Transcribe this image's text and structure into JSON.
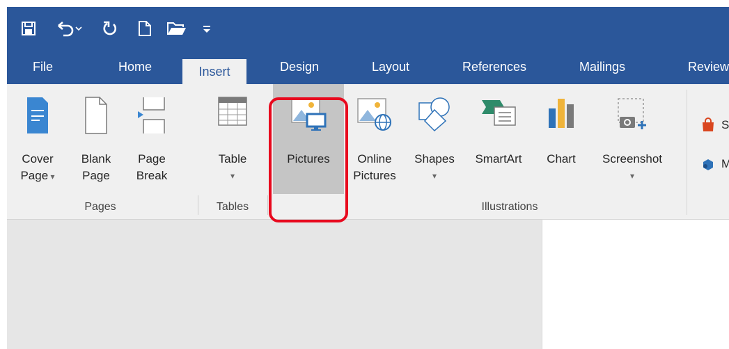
{
  "colors": {
    "accent": "#2b579a",
    "highlight": "#e8091e",
    "ribbon": "#f0f0f0"
  },
  "qat": {
    "items": [
      {
        "name": "save-icon"
      },
      {
        "name": "undo-icon"
      },
      {
        "name": "redo-icon"
      },
      {
        "name": "new-document-icon"
      },
      {
        "name": "open-folder-icon"
      },
      {
        "name": "customize-qat-icon"
      }
    ]
  },
  "tabs": [
    "File",
    "Home",
    "Insert",
    "Design",
    "Layout",
    "References",
    "Mailings",
    "Review"
  ],
  "active_tab": "Insert",
  "groups": {
    "pages": {
      "label": "Pages",
      "cover": {
        "line1": "Cover",
        "line2": "Page"
      },
      "blank": {
        "line1": "Blank",
        "line2": "Page"
      },
      "break": {
        "line1": "Page",
        "line2": "Break"
      }
    },
    "tables": {
      "label": "Tables",
      "table": {
        "line1": "Table"
      }
    },
    "illustrations": {
      "label": "Illustrations",
      "pictures": {
        "line1": "Pictures"
      },
      "online": {
        "line1": "Online",
        "line2": "Pictures"
      },
      "shapes": {
        "line1": "Shapes"
      },
      "smartart": {
        "line1": "SmartArt"
      },
      "chart": {
        "line1": "Chart"
      },
      "screenshot": {
        "line1": "Screenshot"
      }
    }
  },
  "side": {
    "store": "S",
    "addins": "M"
  }
}
